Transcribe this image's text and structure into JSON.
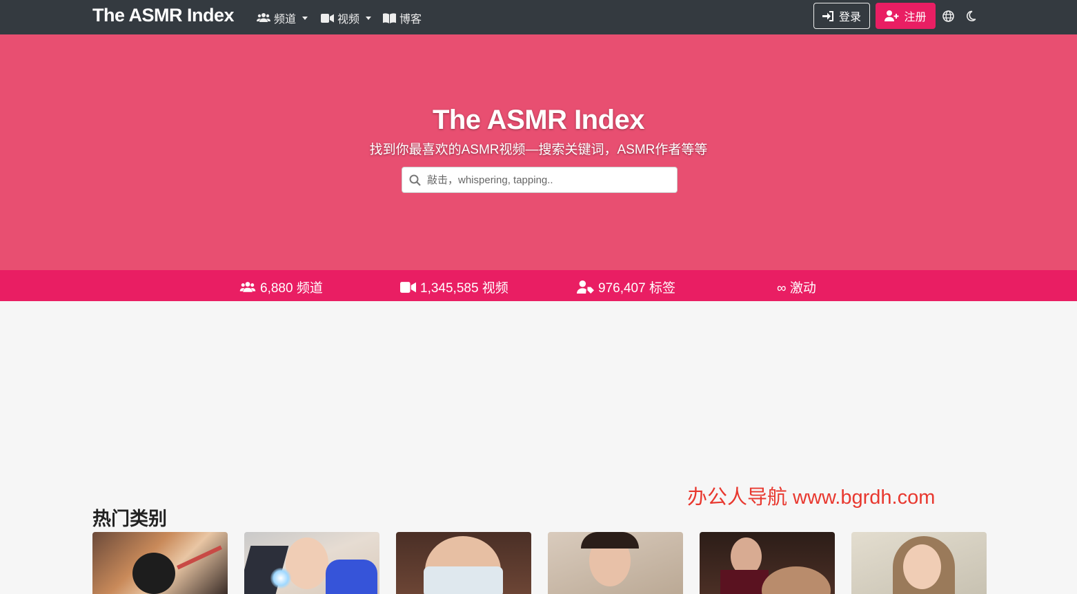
{
  "nav": {
    "brand": "The ASMR Index",
    "items": [
      {
        "label": "频道",
        "icon": "users-icon",
        "dropdown": true
      },
      {
        "label": "视频",
        "icon": "video-icon",
        "dropdown": true
      },
      {
        "label": "博客",
        "icon": "book-icon",
        "dropdown": false
      }
    ],
    "login_label": "登录",
    "register_label": "注册"
  },
  "hero": {
    "title": "The ASMR Index",
    "subtitle": "找到你最喜欢的ASMR视频—搜索关键词，ASMR作者等等",
    "search_placeholder": "敲击，whispering, tapping.."
  },
  "stats": [
    {
      "icon": "users-icon",
      "text": "6,880 频道"
    },
    {
      "icon": "video-icon",
      "text": "1,345,585 视频"
    },
    {
      "icon": "user-tag-icon",
      "text": "976,407 标签"
    },
    {
      "icon": "infinity-icon",
      "text": "∞ 激动"
    }
  ],
  "watermark": "办公人导航  www.bgrdh.com",
  "categories": {
    "title": "热门类别"
  },
  "colors": {
    "navbar": "#343a40",
    "hero": "#e84f71",
    "accent": "#e91e63"
  }
}
